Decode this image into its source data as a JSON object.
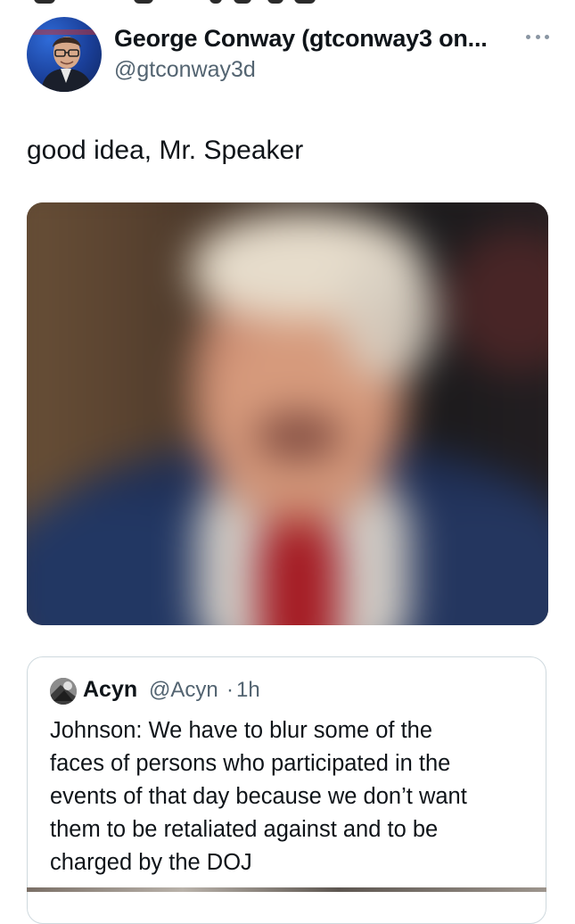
{
  "tweet": {
    "display_name": "George Conway (gtconway3 on...",
    "handle": "@gtconway3d",
    "text": "good idea, Mr. Speaker",
    "media": {
      "description_icon": "blurred-photo"
    }
  },
  "quote": {
    "name": "Acyn",
    "handle": "@Acyn",
    "separator": "·",
    "time": "1h",
    "lines": [
      "Johnson: We have to blur some of the",
      "faces of persons who participated in the",
      "events of that day because we don’t want",
      "them to be retaliated against and to be",
      "charged by the DOJ"
    ]
  },
  "icons": {
    "more": "more-horizontal-icon"
  },
  "colors": {
    "text_primary": "#0f1419",
    "text_secondary": "#536471",
    "border": "#cfd9de",
    "icon_gray": "#8a96a3"
  }
}
